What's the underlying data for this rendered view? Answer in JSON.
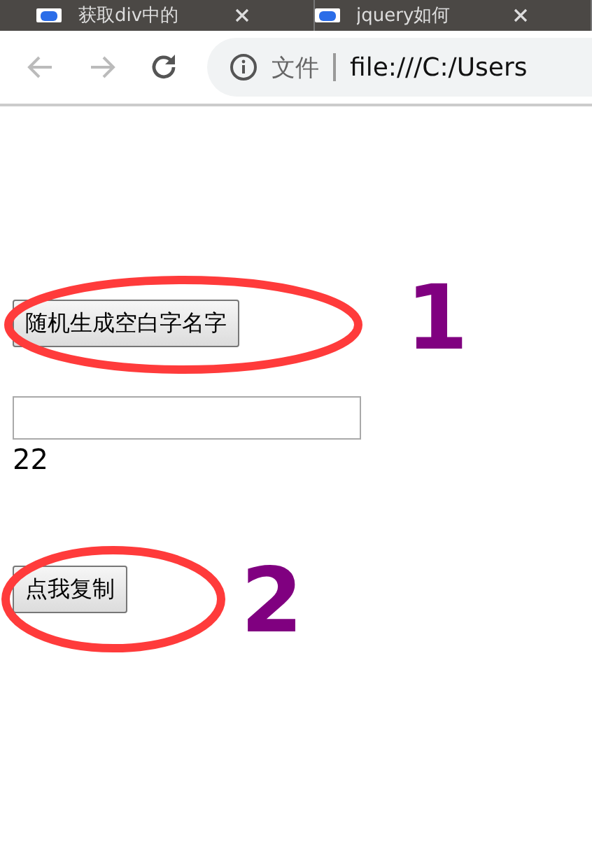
{
  "tabs": [
    {
      "title": "获取div中的",
      "selected": false
    },
    {
      "title": "jquery如何",
      "selected": false
    }
  ],
  "address_bar": {
    "security_label": "文件",
    "url": "file:///C:/Users"
  },
  "page": {
    "generate_button": "随机生成空白字名字",
    "output": "22",
    "copy_button": "点我复制"
  },
  "annotations": [
    {
      "label": "1"
    },
    {
      "label": "2"
    }
  ]
}
